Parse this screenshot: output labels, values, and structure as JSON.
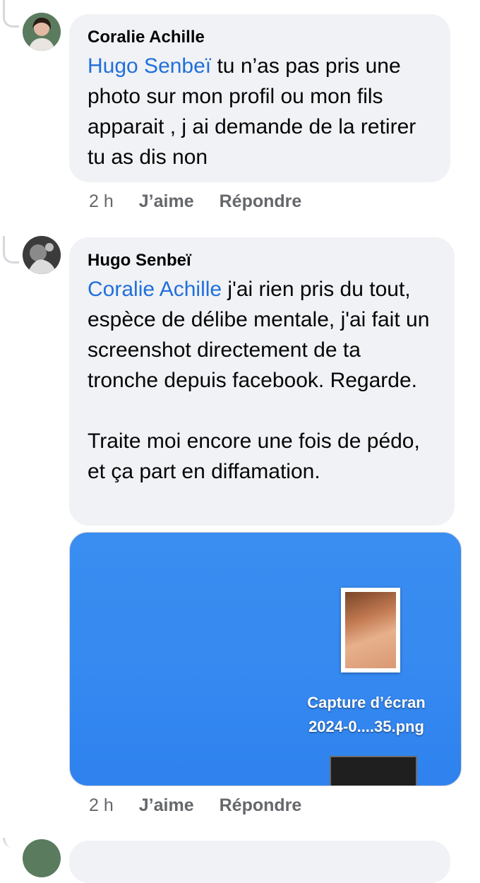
{
  "comments": [
    {
      "author": "Coralie Achille",
      "mention": "Hugo Senbeï",
      "text": " tu n’as pas pris une photo sur mon profil ou mon fils apparait , j ai demande de la retirer tu as dis non",
      "time": "2 h",
      "like_label": "J’aime",
      "reply_label": "Répondre"
    },
    {
      "author": "Hugo Senbeï",
      "mention": "Coralie Achille",
      "text": " j'ai rien pris du tout, espèce de délibe mentale, j'ai fait un screenshot directement de ta tronche depuis facebook. Regarde.\n\nTraite moi encore une fois de pédo, et ça part en diffamation.",
      "time": "2 h",
      "like_label": "J’aime",
      "reply_label": "Répondre",
      "attachment": {
        "file_name_line1": "Capture d’écran",
        "file_name_line2": "2024-0....35.png"
      }
    }
  ],
  "colors": {
    "mention": "#216fdb",
    "bubble": "#f0f2f5",
    "meta": "#65676b",
    "attachment_bg": "#3589f0"
  }
}
